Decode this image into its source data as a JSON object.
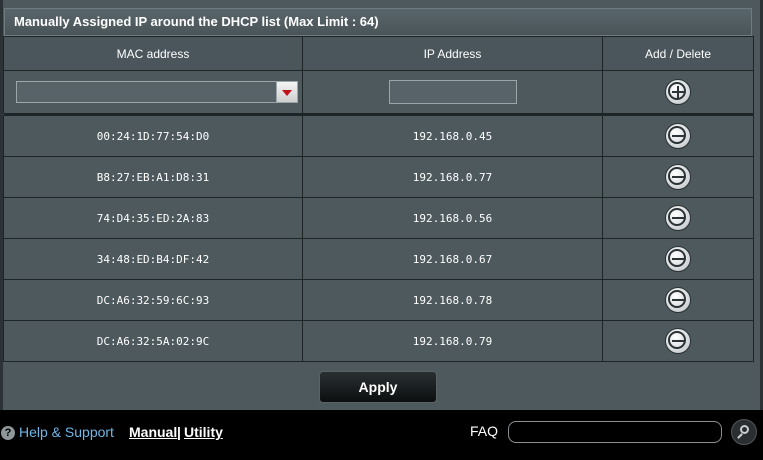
{
  "section": {
    "title": "Manually Assigned IP around the DHCP list (Max Limit : 64)"
  },
  "table": {
    "headers": [
      "MAC address",
      "IP Address",
      "Add / Delete"
    ],
    "new_entry": {
      "mac_value": "",
      "ip_value": "",
      "add_icon": "plus-circle-icon"
    },
    "rows": [
      {
        "mac": "00:24:1D:77:54:D0",
        "ip": "192.168.0.45"
      },
      {
        "mac": "B8:27:EB:A1:D8:31",
        "ip": "192.168.0.77"
      },
      {
        "mac": "74:D4:35:ED:2A:83",
        "ip": "192.168.0.56"
      },
      {
        "mac": "34:48:ED:B4:DF:42",
        "ip": "192.168.0.67"
      },
      {
        "mac": "DC:A6:32:59:6C:93",
        "ip": "192.168.0.78"
      },
      {
        "mac": "DC:A6:32:5A:02:9C",
        "ip": "192.168.0.79"
      }
    ],
    "delete_icon": "minus-circle-icon"
  },
  "apply_label": "Apply",
  "footer": {
    "help_label": "Help & Support",
    "manual_label": "Manual",
    "separator": "|",
    "utility_label": "Utility",
    "faq_label": "FAQ",
    "faq_value": "",
    "search_icon": "search-icon"
  },
  "colors": {
    "panel_bg": "#4d595d",
    "footer_bg": "#000000",
    "help_link": "#6fb6e6",
    "dropdown_arrow": "#c0101a"
  }
}
